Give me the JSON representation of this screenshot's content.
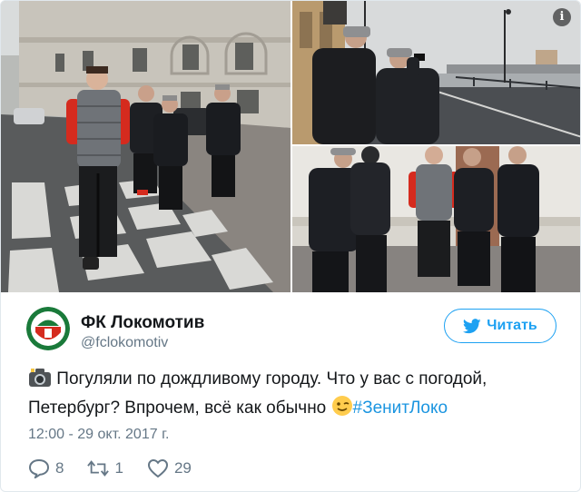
{
  "tweet": {
    "display_name": "ФК Локомотив",
    "handle": "@fclokomotiv",
    "follow_label": "Читать",
    "text_before_hashtag": "Погуляли по дождливому городу. Что у вас с погодой, Петербург? Впрочем, всё как обычно ",
    "hashtag": "#ЗенитЛоко",
    "timestamp": "12:00 - 29 окт. 2017 г.",
    "reply_count": "8",
    "retweet_count": "1",
    "like_count": "29"
  },
  "icons": {
    "info": "info-icon",
    "camera": "camera-emoji-icon",
    "wink": "wink-emoji-icon",
    "bird": "twitter-bird-icon",
    "reply": "reply-icon",
    "retweet": "retweet-icon",
    "like": "heart-icon"
  },
  "colors": {
    "accent": "#1da1f2",
    "hashtag": "#1b95e0",
    "secondary_text": "#657786",
    "club_red": "#d52b1e",
    "club_green": "#1a7a3a"
  }
}
